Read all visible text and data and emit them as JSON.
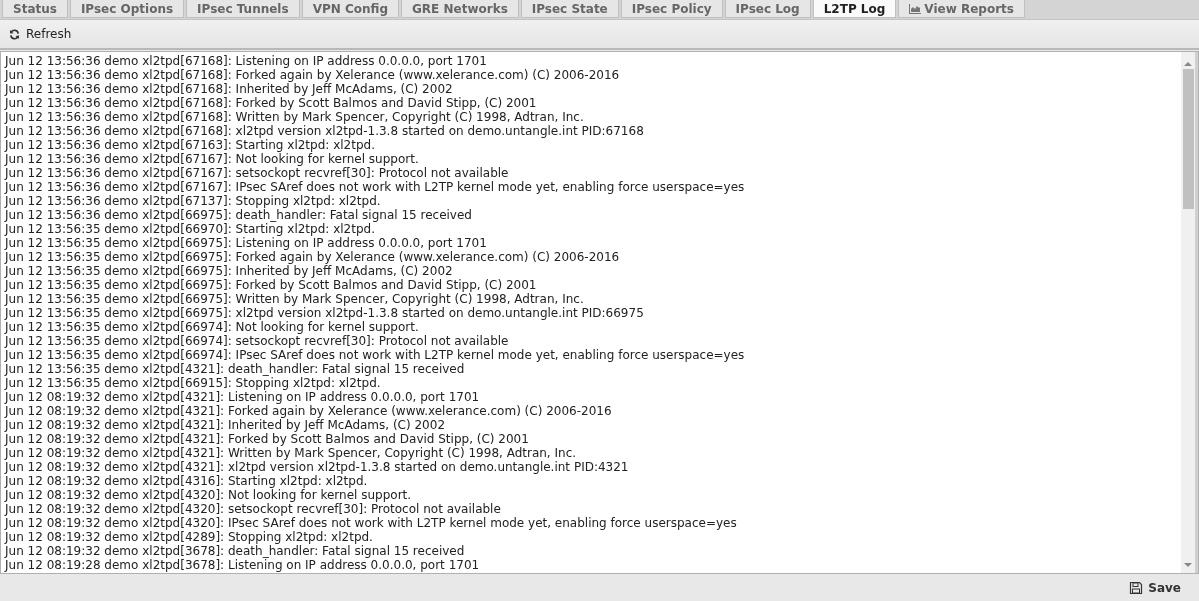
{
  "tabs": [
    {
      "label": "Status",
      "selected": false
    },
    {
      "label": "IPsec Options",
      "selected": false
    },
    {
      "label": "IPsec Tunnels",
      "selected": false
    },
    {
      "label": "VPN Config",
      "selected": false
    },
    {
      "label": "GRE Networks",
      "selected": false
    },
    {
      "label": "IPsec State",
      "selected": false
    },
    {
      "label": "IPsec Policy",
      "selected": false
    },
    {
      "label": "IPsec Log",
      "selected": false
    },
    {
      "label": "L2TP Log",
      "selected": true
    },
    {
      "label": "View Reports",
      "selected": false,
      "kind": "reports"
    }
  ],
  "toolbar": {
    "refresh": "Refresh"
  },
  "log_lines": [
    "Jun 12 13:56:36 demo xl2tpd[67168]: Listening on IP address 0.0.0.0, port 1701",
    "Jun 12 13:56:36 demo xl2tpd[67168]: Forked again by Xelerance (www.xelerance.com) (C) 2006-2016",
    "Jun 12 13:56:36 demo xl2tpd[67168]: Inherited by Jeff McAdams, (C) 2002",
    "Jun 12 13:56:36 demo xl2tpd[67168]: Forked by Scott Balmos and David Stipp, (C) 2001",
    "Jun 12 13:56:36 demo xl2tpd[67168]: Written by Mark Spencer, Copyright (C) 1998, Adtran, Inc.",
    "Jun 12 13:56:36 demo xl2tpd[67168]: xl2tpd version xl2tpd-1.3.8 started on demo.untangle.int PID:67168",
    "Jun 12 13:56:36 demo xl2tpd[67163]: Starting xl2tpd: xl2tpd.",
    "Jun 12 13:56:36 demo xl2tpd[67167]: Not looking for kernel support.",
    "Jun 12 13:56:36 demo xl2tpd[67167]: setsockopt recvref[30]: Protocol not available",
    "Jun 12 13:56:36 demo xl2tpd[67167]: IPsec SAref does not work with L2TP kernel mode yet, enabling force userspace=yes",
    "Jun 12 13:56:36 demo xl2tpd[67137]: Stopping xl2tpd: xl2tpd.",
    "Jun 12 13:56:36 demo xl2tpd[66975]: death_handler: Fatal signal 15 received",
    "Jun 12 13:56:35 demo xl2tpd[66970]: Starting xl2tpd: xl2tpd.",
    "Jun 12 13:56:35 demo xl2tpd[66975]: Listening on IP address 0.0.0.0, port 1701",
    "Jun 12 13:56:35 demo xl2tpd[66975]: Forked again by Xelerance (www.xelerance.com) (C) 2006-2016",
    "Jun 12 13:56:35 demo xl2tpd[66975]: Inherited by Jeff McAdams, (C) 2002",
    "Jun 12 13:56:35 demo xl2tpd[66975]: Forked by Scott Balmos and David Stipp, (C) 2001",
    "Jun 12 13:56:35 demo xl2tpd[66975]: Written by Mark Spencer, Copyright (C) 1998, Adtran, Inc.",
    "Jun 12 13:56:35 demo xl2tpd[66975]: xl2tpd version xl2tpd-1.3.8 started on demo.untangle.int PID:66975",
    "Jun 12 13:56:35 demo xl2tpd[66974]: Not looking for kernel support.",
    "Jun 12 13:56:35 demo xl2tpd[66974]: setsockopt recvref[30]: Protocol not available",
    "Jun 12 13:56:35 demo xl2tpd[66974]: IPsec SAref does not work with L2TP kernel mode yet, enabling force userspace=yes",
    "Jun 12 13:56:35 demo xl2tpd[4321]: death_handler: Fatal signal 15 received",
    "Jun 12 13:56:35 demo xl2tpd[66915]: Stopping xl2tpd: xl2tpd.",
    "Jun 12 08:19:32 demo xl2tpd[4321]: Listening on IP address 0.0.0.0, port 1701",
    "Jun 12 08:19:32 demo xl2tpd[4321]: Forked again by Xelerance (www.xelerance.com) (C) 2006-2016",
    "Jun 12 08:19:32 demo xl2tpd[4321]: Inherited by Jeff McAdams, (C) 2002",
    "Jun 12 08:19:32 demo xl2tpd[4321]: Forked by Scott Balmos and David Stipp, (C) 2001",
    "Jun 12 08:19:32 demo xl2tpd[4321]: Written by Mark Spencer, Copyright (C) 1998, Adtran, Inc.",
    "Jun 12 08:19:32 demo xl2tpd[4321]: xl2tpd version xl2tpd-1.3.8 started on demo.untangle.int PID:4321",
    "Jun 12 08:19:32 demo xl2tpd[4316]: Starting xl2tpd: xl2tpd.",
    "Jun 12 08:19:32 demo xl2tpd[4320]: Not looking for kernel support.",
    "Jun 12 08:19:32 demo xl2tpd[4320]: setsockopt recvref[30]: Protocol not available",
    "Jun 12 08:19:32 demo xl2tpd[4320]: IPsec SAref does not work with L2TP kernel mode yet, enabling force userspace=yes",
    "Jun 12 08:19:32 demo xl2tpd[4289]: Stopping xl2tpd: xl2tpd.",
    "Jun 12 08:19:32 demo xl2tpd[3678]: death_handler: Fatal signal 15 received",
    "Jun 12 08:19:28 demo xl2tpd[3678]: Listening on IP address 0.0.0.0, port 1701"
  ],
  "footer": {
    "save": "Save"
  }
}
